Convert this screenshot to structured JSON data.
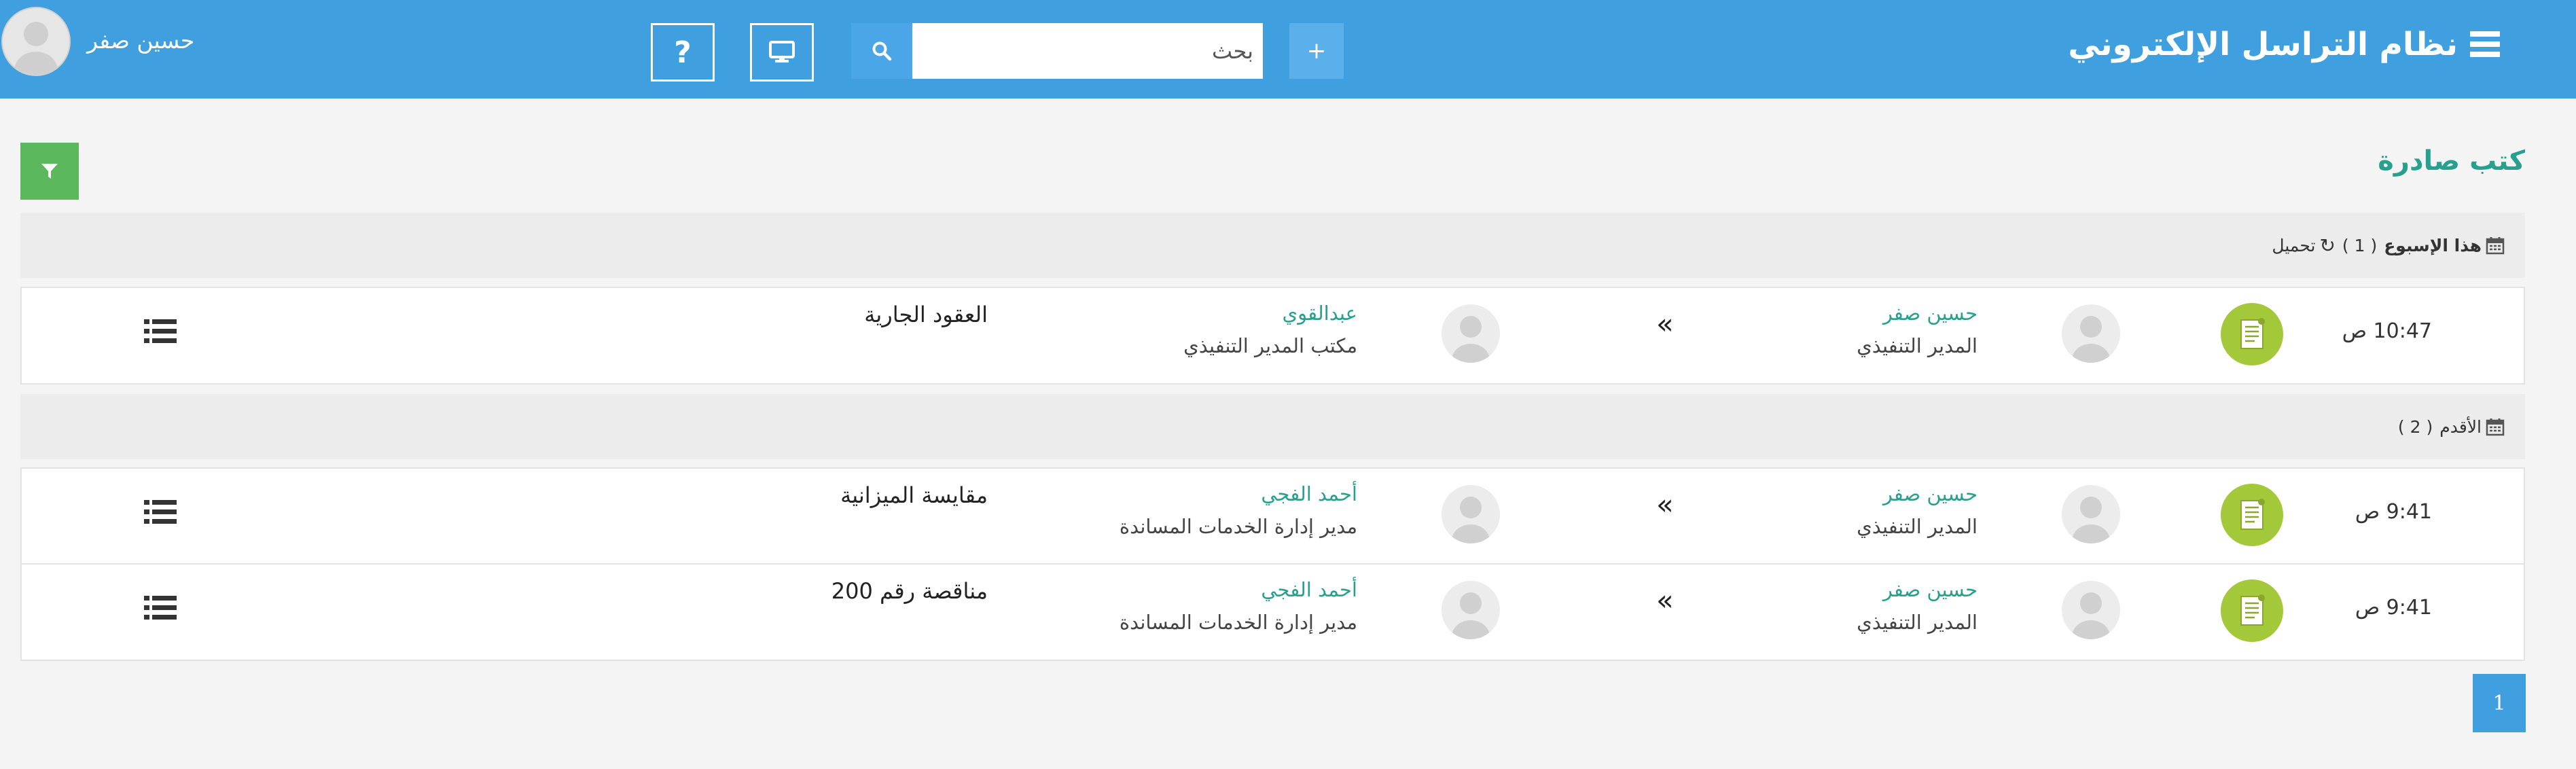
{
  "header": {
    "app_title": "نظام التراسل الإلكتروني",
    "add_label": "+",
    "search_placeholder": "بحث",
    "help_label": "?",
    "user_name": "حسين صفر"
  },
  "page": {
    "title": "كتب صادرة"
  },
  "groups": [
    {
      "label": "هذا الإسبوع",
      "count": "( 1 )",
      "load_label": "تحميل",
      "rows": [
        {
          "time": "10:47 ص",
          "sender_name": "حسين صفر",
          "sender_title": "المدير التنفيذي",
          "recipient_name": "عبدالقوي",
          "recipient_title": "مكتب المدير التنفيذي",
          "subject": "العقود الجارية"
        }
      ]
    },
    {
      "label": "الأقدم",
      "count": "( 2 )",
      "rows": [
        {
          "time": "9:41 ص",
          "sender_name": "حسين صفر",
          "sender_title": "المدير التنفيذي",
          "recipient_name": "أحمد الفجي",
          "recipient_title": "مدير إدارة الخدمات المساندة",
          "subject": "مقايسة الميزانية"
        },
        {
          "time": "9:41 ص",
          "sender_name": "حسين صفر",
          "sender_title": "المدير التنفيذي",
          "recipient_name": "أحمد الفجي",
          "recipient_title": "مدير إدارة الخدمات المساندة",
          "subject": "مناقصة رقم 200"
        }
      ]
    }
  ],
  "pagination": {
    "current_page": "1"
  },
  "colors": {
    "header_bg": "#3f9fdf",
    "accent_teal": "#27a08e",
    "filter_green": "#5cb85c",
    "doc_icon_green": "#a3c93a"
  },
  "icons": {
    "menu": "hamburger-icon",
    "search": "search-icon",
    "screen": "monitor-icon",
    "help": "question-icon",
    "filter": "filter-icon",
    "calendar": "calendar-icon",
    "refresh": "refresh-icon",
    "document": "document-icon",
    "forward": "double-chevron-left-icon",
    "actions": "list-icon"
  }
}
